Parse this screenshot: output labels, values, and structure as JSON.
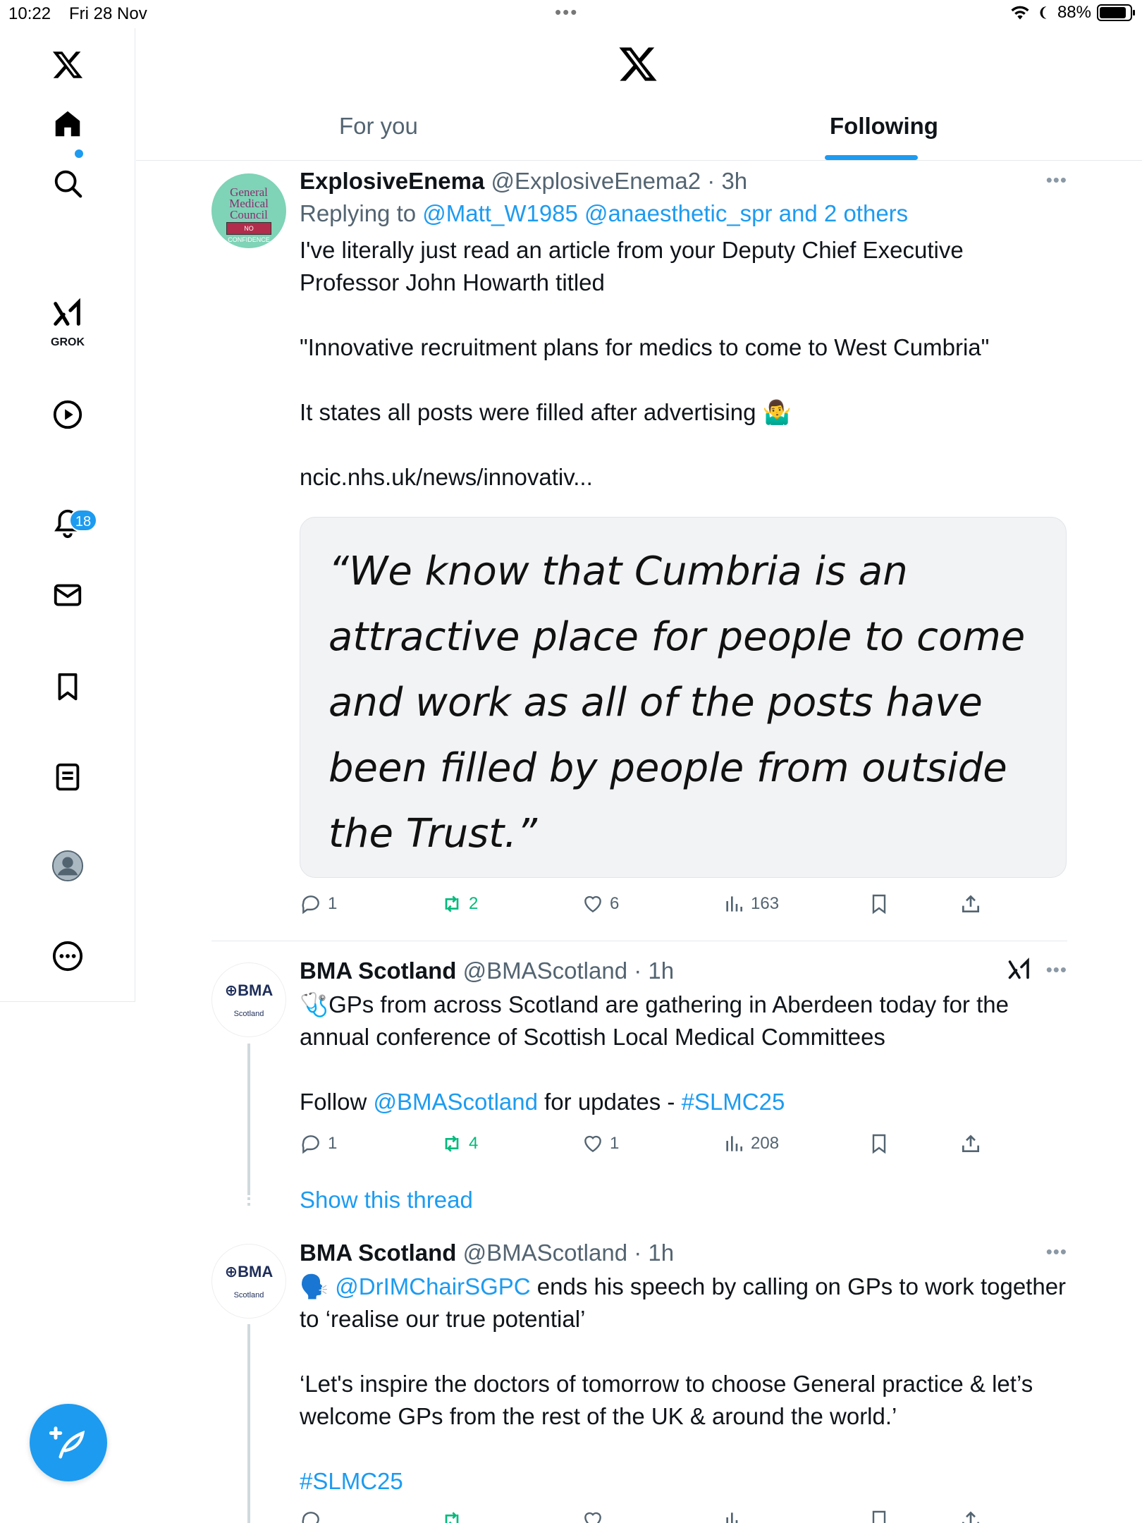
{
  "status": {
    "time": "10:22",
    "date": "Fri 28 Nov",
    "battery": "88%",
    "battery_level": 0.88
  },
  "nav": {
    "grok_label": "GROK",
    "notifications_badge": "18"
  },
  "tabs": {
    "for_you": "For you",
    "following": "Following"
  },
  "tweets": [
    {
      "name": "ExplosiveEnema",
      "handle": "@ExplosiveEnema2 · 3h",
      "reply_prefix": "Replying to",
      "reply_to": "@Matt_W1985 @anaesthetic_spr and 2 others",
      "avatar_text": "General Medical Council",
      "avatar_stamp": "NO CONFIDENCE",
      "text": "I've literally just read an article from your Deputy Chief Executive Professor John Howarth titled\n\n\"Innovative recruitment plans for medics to come to West Cumbria\"\n\nIt states all posts were filled after advertising 🤷‍♂️",
      "link": "ncic.nhs.uk/news/innovativ...",
      "card_quote": "“We know that Cumbria is an attractive place for people to come and work as all of the posts have been filled by people from outside the Trust.”",
      "replies": "1",
      "retweets": "2",
      "likes": "6",
      "views": "163"
    },
    {
      "name": "BMA Scotland",
      "handle": "@BMAScotland · 1h",
      "avatar_logo": "⊕BMA",
      "avatar_sub": "Scotland",
      "text_a": "🩺GPs from across Scotland are gathering in Aberdeen today for the annual conference of Scottish Local Medical Committees\n\nFollow ",
      "mention": "@BMAScotland",
      "text_b": " for updates - ",
      "hashtag": "#SLMC25",
      "replies": "1",
      "retweets": "4",
      "likes": "1",
      "views": "208",
      "show_thread": "Show this thread"
    },
    {
      "name": "BMA Scotland",
      "handle": "@BMAScotland · 1h",
      "avatar_logo": "⊕BMA",
      "avatar_sub": "Scotland",
      "emoji": "🗣️ ",
      "mention": "@DrIMChairSGPC",
      "text_a": " ends his speech by calling on GPs to work together to ‘realise our true potential’\n\n‘Let's inspire the doctors of tomorrow to choose General practice & let’s welcome GPs from the rest of the UK & around the world.’\n\n",
      "hashtag": "#SLMC25"
    }
  ],
  "colors": {
    "accent": "#1d9bf0",
    "retweet": "#00ba7c",
    "secondary_text": "#536471"
  }
}
